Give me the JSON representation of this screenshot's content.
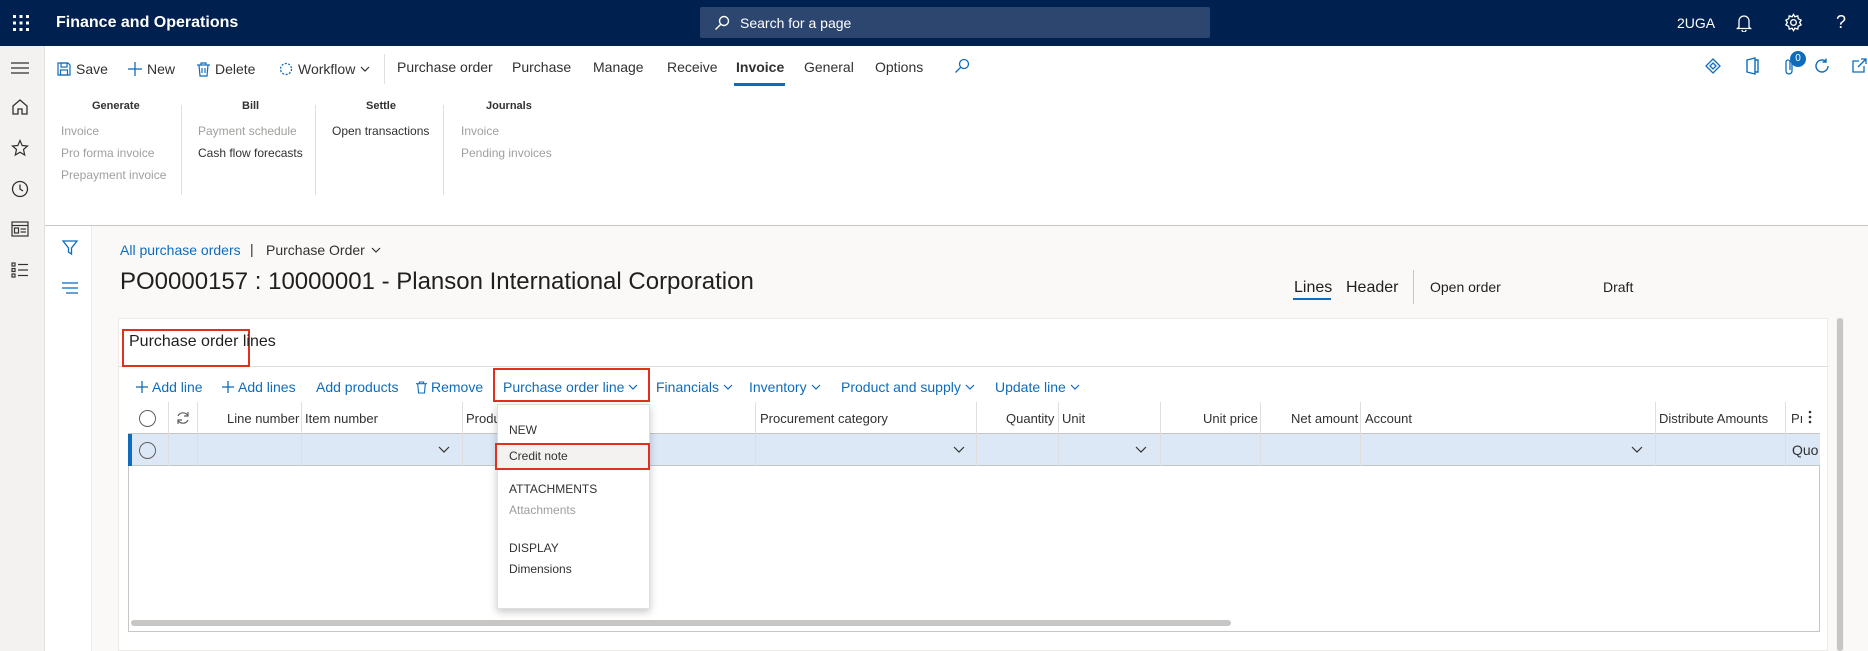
{
  "app": {
    "title": "Finance and Operations",
    "company": "2UGA",
    "notification_count": "0"
  },
  "search": {
    "placeholder": "Search for a page"
  },
  "actions": {
    "save": "Save",
    "new": "New",
    "delete": "Delete",
    "workflow": "Workflow"
  },
  "tabs": [
    "Purchase order",
    "Purchase",
    "Manage",
    "Receive",
    "Invoice",
    "General",
    "Options"
  ],
  "selected_tab": "Invoice",
  "ribbon": {
    "generate": {
      "title": "Generate",
      "items": [
        "Invoice",
        "Pro forma invoice",
        "Prepayment invoice"
      ]
    },
    "bill": {
      "title": "Bill",
      "items": [
        "Payment schedule",
        "Cash flow forecasts"
      ]
    },
    "settle": {
      "title": "Settle",
      "items": [
        "Open transactions"
      ]
    },
    "journals": {
      "title": "Journals",
      "items": [
        "Invoice",
        "Pending invoices"
      ]
    }
  },
  "breadcrumb": {
    "link": "All purchase orders",
    "separator": "|",
    "current": "Purchase Order"
  },
  "page": {
    "title": "PO0000157 : 10000001 - Planson International Corporation"
  },
  "header_right": {
    "lines": "Lines",
    "header": "Header",
    "status": "Open order",
    "approval": "Draft"
  },
  "lines": {
    "section_title": "Purchase order lines",
    "toolbar": [
      "Add line",
      "Add lines",
      "Add products",
      "Remove",
      "Purchase order line",
      "Financials",
      "Inventory",
      "Product and supply",
      "Update line"
    ],
    "columns": [
      "Line number",
      "Item number",
      "Produ",
      "Procurement category",
      "Quantity",
      "Unit",
      "Unit price",
      "Net amount",
      "Account",
      "Distribute Amounts",
      "Pı"
    ],
    "row": {
      "last_cell": "Quo"
    }
  },
  "menu": {
    "new_header": "NEW",
    "credit_note": "Credit note",
    "attachments_header": "ATTACHMENTS",
    "attachments": "Attachments",
    "display_header": "DISPLAY",
    "dimensions": "Dimensions"
  },
  "colors": {
    "topbar": "#002050",
    "accent": "#0f6cbd",
    "highlight": "#e0301e",
    "row_selected": "#dde8f7"
  }
}
